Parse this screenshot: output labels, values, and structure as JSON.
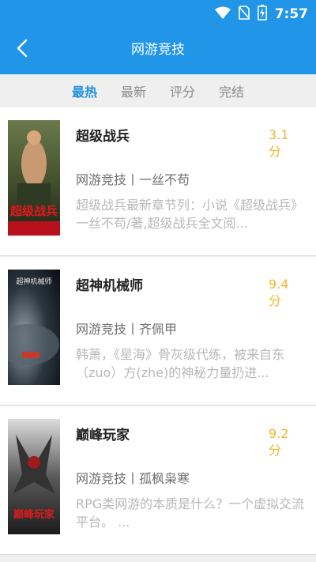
{
  "status": {
    "time": "7:57"
  },
  "header": {
    "title": "网游竞技"
  },
  "tabs": [
    {
      "label": "最热",
      "active": true
    },
    {
      "label": "最新",
      "active": false
    },
    {
      "label": "评分",
      "active": false
    },
    {
      "label": "完结",
      "active": false
    }
  ],
  "books": [
    {
      "title": "超级战兵",
      "score_value": "3.1",
      "score_unit": "分",
      "meta": "网游竞技丨一丝不苟",
      "desc": "超级战兵最新章节列：小说《超级战兵》一丝不苟/著,超级战兵全文阅...",
      "cover_text": "超级战兵"
    },
    {
      "title": "超神机械师",
      "score_value": "9.4",
      "score_unit": "分",
      "meta": "网游竞技丨齐佩甲",
      "desc": "韩萧，《星海》骨灰级代练，被来自东（zuo）方(zhe)的神秘力量扔进...",
      "cover_text": "超神机械师"
    },
    {
      "title": "巅峰玩家",
      "score_value": "9.2",
      "score_unit": "分",
      "meta": "网游竞技丨孤枫枭寒",
      "desc": "RPG类网游的本质是什么？一个虚拟交流平台。 ...",
      "cover_text": "巅峰玩家"
    }
  ],
  "colors": {
    "primary": "#2196e8",
    "accent_score": "#f2b52b",
    "active_tab": "#1e90e0"
  }
}
